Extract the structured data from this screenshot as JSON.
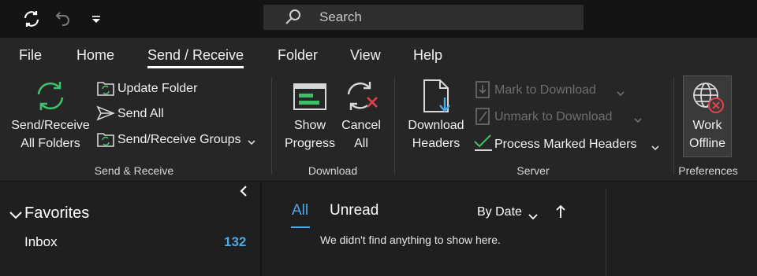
{
  "search": {
    "placeholder": "Search"
  },
  "tabs": [
    "File",
    "Home",
    "Send / Receive",
    "Folder",
    "View",
    "Help"
  ],
  "ribbon": {
    "send_receive_all": [
      "Send/Receive",
      "All Folders"
    ],
    "update_folder": "Update Folder",
    "send_all": "Send All",
    "send_receive_groups": "Send/Receive Groups",
    "group_send_receive": "Send & Receive",
    "show_progress": [
      "Show",
      "Progress"
    ],
    "cancel_all": [
      "Cancel",
      "All"
    ],
    "group_download": "Download",
    "download_headers": [
      "Download",
      "Headers"
    ],
    "mark_to_download": "Mark to Download",
    "unmark_to_download": "Unmark to Download",
    "process_marked_headers": "Process Marked Headers",
    "group_server": "Server",
    "work_offline": [
      "Work",
      "Offline"
    ],
    "group_preferences": "Preferences"
  },
  "folders": {
    "favorites": "Favorites",
    "inbox": "Inbox",
    "inbox_count": "132"
  },
  "mail": {
    "filter_all": "All",
    "filter_unread": "Unread",
    "sort": "By Date",
    "empty": "We didn't find anything to show here."
  },
  "colors": {
    "accent": "#4fa8e6",
    "green": "#3fbf6a",
    "red": "#e0424b"
  }
}
